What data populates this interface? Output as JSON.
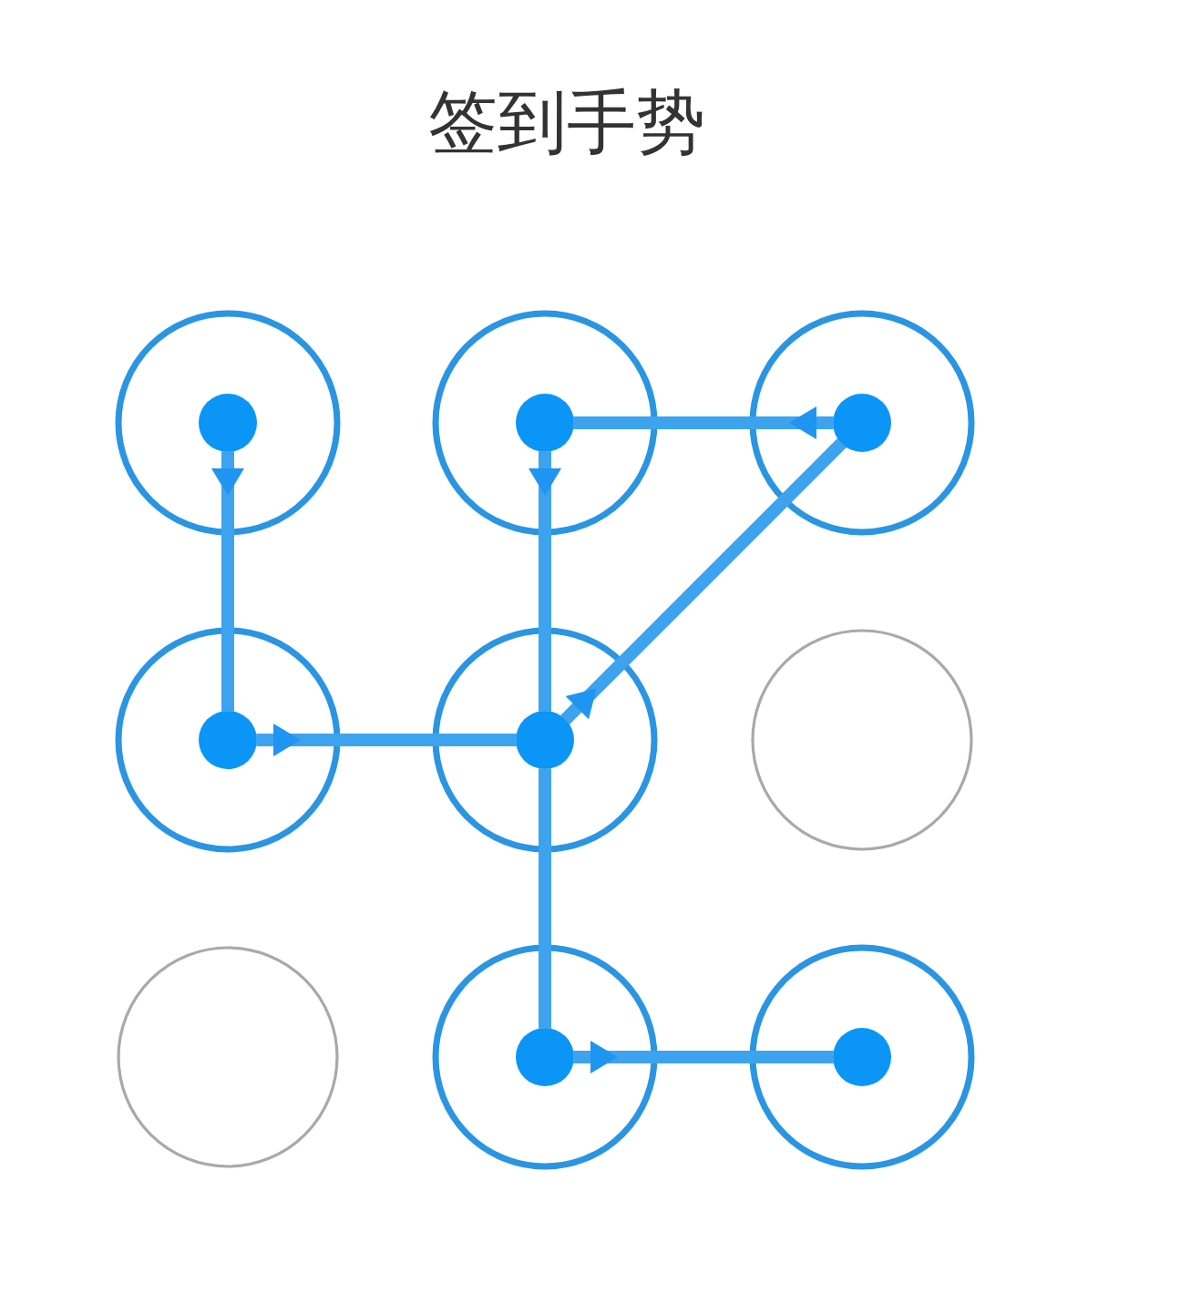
{
  "title": "签到手势",
  "pattern": {
    "nodes": [
      {
        "selected": true,
        "kind": "down"
      },
      {
        "selected": true,
        "kind": "down_two"
      },
      {
        "selected": true,
        "kind": "left"
      },
      {
        "selected": true,
        "kind": "right"
      },
      {
        "selected": true,
        "kind": "up_right"
      },
      {
        "selected": false,
        "kind": "idle"
      },
      {
        "selected": false,
        "kind": "idle"
      },
      {
        "selected": true,
        "kind": "right"
      },
      {
        "selected": true,
        "kind": "end"
      }
    ]
  }
}
